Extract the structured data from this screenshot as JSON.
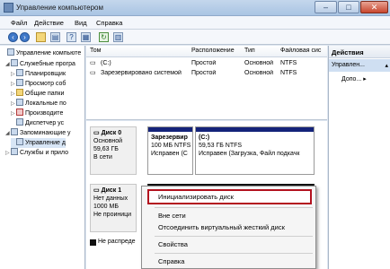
{
  "window": {
    "title": "Управление компьютером",
    "controls": {
      "minimize": "–",
      "maximize": "□",
      "close": "✕"
    }
  },
  "menu": [
    "Файл",
    "Действие",
    "Вид",
    "Справка"
  ],
  "toolbar_icons": [
    "back-icon",
    "forward-icon",
    "up-folder-icon",
    "show-tree-icon",
    "help-icon",
    "properties-icon",
    "refresh-icon",
    "export-icon"
  ],
  "tree": [
    {
      "label": "Управление компьюте",
      "indent": 0,
      "exp": ""
    },
    {
      "label": "Служебные програ",
      "indent": 1,
      "exp": "◢"
    },
    {
      "label": "Планировщик",
      "indent": 2,
      "exp": "▷"
    },
    {
      "label": "Просмотр соб",
      "indent": 2,
      "exp": "▷"
    },
    {
      "label": "Общие папки",
      "indent": 2,
      "exp": "▷"
    },
    {
      "label": "Локальные по",
      "indent": 2,
      "exp": "▷"
    },
    {
      "label": "Производите",
      "indent": 2,
      "exp": "▷"
    },
    {
      "label": "Диспетчер ус",
      "indent": 2,
      "exp": ""
    },
    {
      "label": "Запоминающие у",
      "indent": 1,
      "exp": "◢"
    },
    {
      "label": "Управление д",
      "indent": 2,
      "exp": ""
    },
    {
      "label": "Службы и прило",
      "indent": 1,
      "exp": "▷"
    }
  ],
  "list": {
    "columns": [
      "Том",
      "Расположение",
      "Тип",
      "Файловая сис"
    ],
    "rows": [
      [
        "(C:)",
        "Простой",
        "Основной",
        "NTFS"
      ],
      [
        "Зарезервировано системой",
        "Простой",
        "Основной",
        "NTFS"
      ]
    ]
  },
  "disks": [
    {
      "name": "Диск 0",
      "type": "Основной",
      "size": "59,63 ГБ",
      "status": "В сети",
      "partitions": [
        {
          "title": "Зарезервир",
          "line1": "100 МБ NTFS",
          "line2": "Исправен (С"
        },
        {
          "title": "(C:)",
          "line1": "59,53 ГБ NTFS",
          "line2": "Исправен (Загрузка, Файл подкачк"
        }
      ]
    },
    {
      "name": "Диск 1",
      "type": "Нет данных",
      "size": "1000 МБ",
      "status": "Не проиници"
    }
  ],
  "legend": {
    "unallocated": "Не распреде"
  },
  "actions": {
    "header": "Действия",
    "subheader": "Управлен...",
    "more": "Допо..."
  },
  "context_menu": {
    "items": [
      "Инициализировать диск",
      "Вне сети",
      "Отсоединить виртуальный жесткий диск",
      "Свойства",
      "Справка"
    ],
    "highlighted_index": 0,
    "highlight_color": "#b3121f"
  }
}
